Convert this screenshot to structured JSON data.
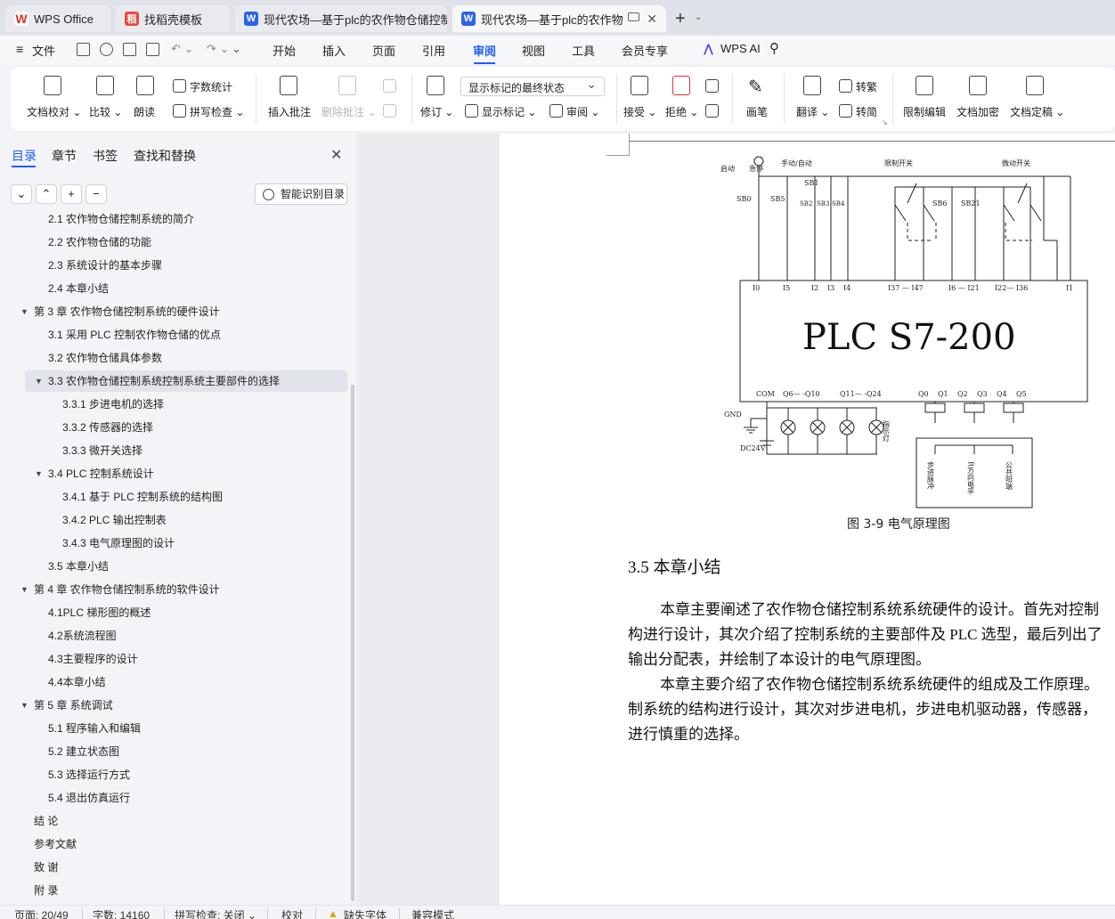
{
  "tabs": [
    {
      "label": "WPS Office",
      "icon": "wps-icon"
    },
    {
      "label": "找稻壳模板",
      "icon": "docer-icon"
    },
    {
      "label": "现代农场—基于plc的农作物仓储控制",
      "icon": "word-doc-icon"
    },
    {
      "label": "现代农场—基于plc的农作物仓",
      "icon": "word-doc-icon"
    }
  ],
  "menu": {
    "file": "文件",
    "items": [
      "开始",
      "插入",
      "页面",
      "引用",
      "审阅",
      "视图",
      "工具",
      "会员专享"
    ],
    "active": "审阅",
    "ai": "WPS AI"
  },
  "ribbon": {
    "doc_check": "文档校对",
    "compare": "比较",
    "read_aloud": "朗读",
    "word_count": "字数统计",
    "spell_check": "拼写检查",
    "insert_comment": "插入批注",
    "delete_comment": "删除批注",
    "revise": "修订",
    "display_select": "显示标记的最终状态",
    "show_marks": "显示标记",
    "review": "审阅",
    "accept": "接受",
    "reject": "拒绝",
    "pen": "画笔",
    "translate": "翻译",
    "to_traditional": "转繁",
    "to_simplified": "转简",
    "restrict_edit": "限制编辑",
    "encrypt": "文档加密",
    "finalize": "文档定稿"
  },
  "panel": {
    "tabs": [
      "目录",
      "章节",
      "书签",
      "查找和替换"
    ],
    "active_tab": "目录",
    "smart_toc": "智能识别目录",
    "toc": [
      {
        "text": "2.1  农作物仓储控制系统的简介",
        "level": 2
      },
      {
        "text": "2.2  农作物仓储的功能",
        "level": 2
      },
      {
        "text": "2.3 系统设计的基本步骤",
        "level": 2
      },
      {
        "text": "2.4 本章小结",
        "level": 2
      },
      {
        "text": "第 3 章  农作物仓储控制系统的硬件设计",
        "level": 1,
        "expanded": true
      },
      {
        "text": "3.1  采用 PLC 控制农作物仓储的优点",
        "level": 2
      },
      {
        "text": "3.2  农作物仓储具体参数",
        "level": 2
      },
      {
        "text": "3.3  农作物仓储控制系统控制系统主要部件的选择",
        "level": 2,
        "expanded": true,
        "selected": true
      },
      {
        "text": "3.3.1 步进电机的选择",
        "level": 3
      },
      {
        "text": "3.3.2  传感器的选择",
        "level": 3
      },
      {
        "text": "3.3.3  微开关选择",
        "level": 3
      },
      {
        "text": "3.4 PLC 控制系统设计",
        "level": 2,
        "expanded": true
      },
      {
        "text": "3.4.1  基于 PLC 控制系统的结构图",
        "level": 3
      },
      {
        "text": "3.4.2 PLC 输出控制表",
        "level": 3
      },
      {
        "text": "3.4.3  电气原理图的设计",
        "level": 3
      },
      {
        "text": "3.5  本章小结",
        "level": 2
      },
      {
        "text": "第 4 章  农作物仓储控制系统的软件设计",
        "level": 1,
        "expanded": true
      },
      {
        "text": "4.1PLC 梯形图的概述",
        "level": 2
      },
      {
        "text": "4.2系统流程图",
        "level": 2
      },
      {
        "text": "4.3主要程序的设计",
        "level": 2
      },
      {
        "text": "4.4本章小结",
        "level": 2
      },
      {
        "text": "第 5 章  系统调试",
        "level": 1,
        "expanded": true
      },
      {
        "text": "5.1  程序输入和编辑",
        "level": 2
      },
      {
        "text": "5.2  建立状态图",
        "level": 2
      },
      {
        "text": "5.3  选择运行方式",
        "level": 2
      },
      {
        "text": "5.4  退出仿真运行",
        "level": 2
      },
      {
        "text": "结  论",
        "level": 1
      },
      {
        "text": "参考文献",
        "level": 1
      },
      {
        "text": "致  谢",
        "level": 1
      },
      {
        "text": "附  录",
        "level": 1
      }
    ]
  },
  "document": {
    "diagram": {
      "plc_label": "PLC   S7-200",
      "top_labels": {
        "start": "启动",
        "stop": "急停",
        "manual_auto": "手动/自动",
        "limit": "限制开关",
        "micro": "微动开关"
      },
      "switch_labels": [
        "SB0",
        "SB5",
        "SB1",
        "SB2",
        "SB3",
        "SB4",
        "SB6",
        "SB21"
      ],
      "inputs": [
        "I0",
        "I5",
        "I2",
        "I3",
        "I4",
        "I37 — I47",
        "I6 — I21",
        "I22— I36",
        "I1"
      ],
      "outputs": [
        "COM",
        "Q6— -Q10",
        "Q11— -Q24",
        "Q0",
        "Q1",
        "Q2",
        "Q3",
        "Q4",
        "Q5"
      ],
      "gnd": "GND",
      "dc": "DC24V",
      "lamp_label": "指示灯",
      "driver_labels": [
        "步进脉冲",
        "R方向电平",
        "公共阳端"
      ]
    },
    "figure_caption": "图 3-9  电气原理图",
    "section_title": "3.5  本章小结",
    "paragraphs": [
      "本章主要阐述了农作物仓储控制系统系统硬件的设计。首先对控制",
      "构进行设计，其次介绍了控制系统的主要部件及 PLC 选型，最后列出了",
      "输出分配表，并绘制了本设计的电气原理图。",
      "本章主要介绍了农作物仓储控制系统系统硬件的组成及工作原理。",
      "制系统的结构进行设计，其次对步进电机，步进电机驱动器，传感器，",
      "进行慎重的选择。"
    ]
  },
  "status": {
    "page": "页面: 20/49",
    "words": "字数: 14160",
    "spell": "拼写检查: 关闭",
    "proof": "校对",
    "missing_font": "缺失字体",
    "compat": "兼容模式"
  }
}
